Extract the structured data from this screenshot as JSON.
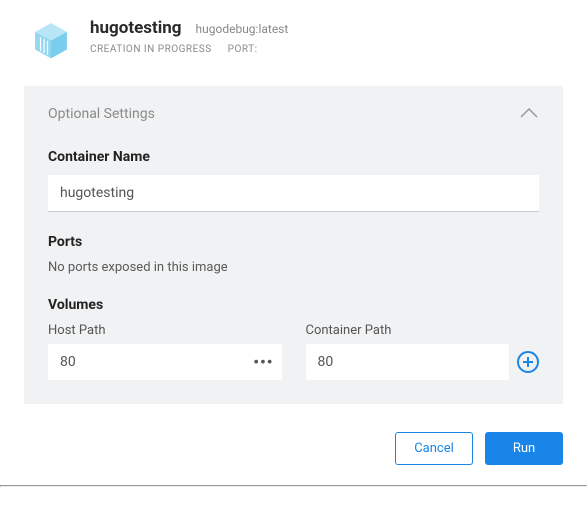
{
  "header": {
    "title": "hugotesting",
    "image_tag": "hugodebug:latest",
    "status": "CREATION IN PROGRESS",
    "port_label": "PORT:"
  },
  "panel": {
    "title": "Optional Settings",
    "container_name": {
      "label": "Container Name",
      "value": "hugotesting"
    },
    "ports": {
      "label": "Ports",
      "empty_message": "No ports exposed in this image"
    },
    "volumes": {
      "label": "Volumes",
      "host_path_label": "Host Path",
      "container_path_label": "Container Path",
      "rows": [
        {
          "host": "80",
          "container": "80"
        }
      ]
    }
  },
  "footer": {
    "cancel": "Cancel",
    "run": "Run"
  }
}
